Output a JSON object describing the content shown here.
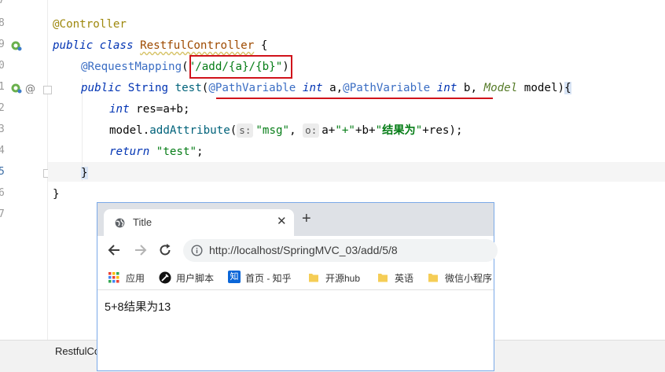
{
  "editor": {
    "line_numbers": [
      "7",
      "8",
      "9",
      "0",
      "1",
      "2",
      "3",
      "4",
      "5",
      "6",
      "7"
    ],
    "lines": {
      "l8_annotation": "@Controller",
      "l9_public": "public",
      "l9_class": "class",
      "l9_name": "RestfulController",
      "l9_brace": " {",
      "l10_annotation": "@RequestMapping",
      "l10_open": "(",
      "l10_path": "\"/add/{a}/{b}\"",
      "l10_close": ")",
      "l11_public": "public",
      "l11_type": "String",
      "l11_method": "test",
      "l11_open": "(",
      "l11_ann1": "@PathVariable",
      "l11_int1": "int",
      "l11_a": " a,",
      "l11_ann2": "@PathVariable",
      "l11_int2": "int",
      "l11_b": " b, ",
      "l11_model_type": "Model",
      "l11_model": " model)",
      "l11_brace": "{",
      "l12_int": "int",
      "l12_rest": " res=a+b;",
      "l13_obj": "model.",
      "l13_method": "addAttribute",
      "l13_open": "(",
      "l13_hint_s": "s:",
      "l13_msg": "\"msg\"",
      "l13_comma": ",",
      "l13_hint_o": "o:",
      "l13_a": "a+",
      "l13_plus": "\"+\"",
      "l13_b": "+b+",
      "l13_q1": "\"",
      "l13_cn": "结果为",
      "l13_q2": "\"",
      "l13_res": "+res);",
      "l14_return": "return",
      "l14_str": "\"test\"",
      "l14_semi": ";",
      "l15_brace": "}",
      "l16_brace": "}"
    },
    "bottom_tab": "RestfulCo"
  },
  "browser": {
    "tab_title": "Title",
    "tab_close": "✕",
    "new_tab": "+",
    "url": "http://localhost/SpringMVC_03/add/5/8",
    "bookmarks": [
      "应用",
      "用户脚本",
      "首页 - 知乎",
      "开源hub",
      "英语",
      "微信小程序"
    ],
    "zhihu_badge": "知",
    "page_text": "5+8结果为13"
  },
  "colors": {
    "annotation_red": "#d0131b",
    "keyword": "#0033b3",
    "string": "#067d17",
    "browser_border": "#7aa9e8"
  }
}
